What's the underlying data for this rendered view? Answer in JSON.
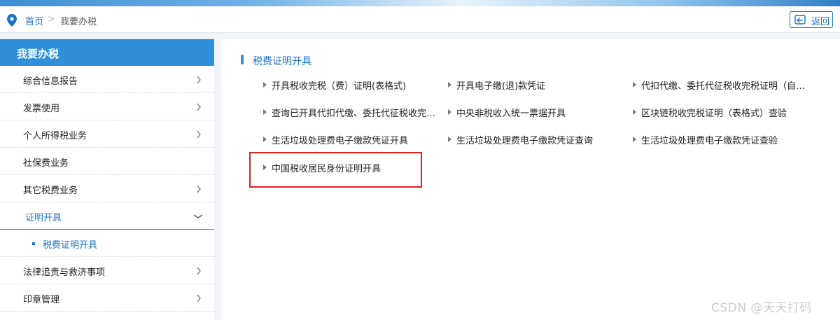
{
  "breadcrumb": {
    "home": "首页",
    "separator": ">",
    "current": "我要办税"
  },
  "back_button": {
    "label": "返回"
  },
  "sidebar": {
    "title": "我要办税",
    "items": [
      {
        "label": "综合信息报告",
        "arrow": "right"
      },
      {
        "label": "发票使用",
        "arrow": "right"
      },
      {
        "label": "个人所得税业务",
        "arrow": "right"
      },
      {
        "label": "社保费业务",
        "arrow": "none"
      },
      {
        "label": "其它税费业务",
        "arrow": "right"
      },
      {
        "label": "证明开具",
        "arrow": "down"
      },
      {
        "label": "法律追责与救济事项",
        "arrow": "right"
      },
      {
        "label": "印章管理",
        "arrow": "right"
      }
    ],
    "subitems": [
      {
        "label": "税费证明开具"
      }
    ]
  },
  "content": {
    "section_title": "税费证明开具",
    "links": [
      {
        "label": "开具税收完税（费）证明(表格式)"
      },
      {
        "label": "开具电子缴(退)款凭证"
      },
      {
        "label": "代扣代缴、委托代征税收完税证明（自…"
      },
      {
        "label": "查询已开具代扣代缴、委托代征税收完…"
      },
      {
        "label": "中央非税收入统一票据开具"
      },
      {
        "label": "区块链税收完税证明（表格式）查验"
      },
      {
        "label": "生活垃圾处理费电子缴款凭证开具"
      },
      {
        "label": "生活垃圾处理费电子缴款凭证查询"
      },
      {
        "label": "生活垃圾处理费电子缴款凭证查验"
      },
      {
        "label": "中国税收居民身份证明开具"
      }
    ]
  },
  "watermark": "CSDN @天天打码",
  "colors": {
    "accent": "#2f8fd9",
    "link": "#1a73c8",
    "highlight": "#e0201e"
  }
}
